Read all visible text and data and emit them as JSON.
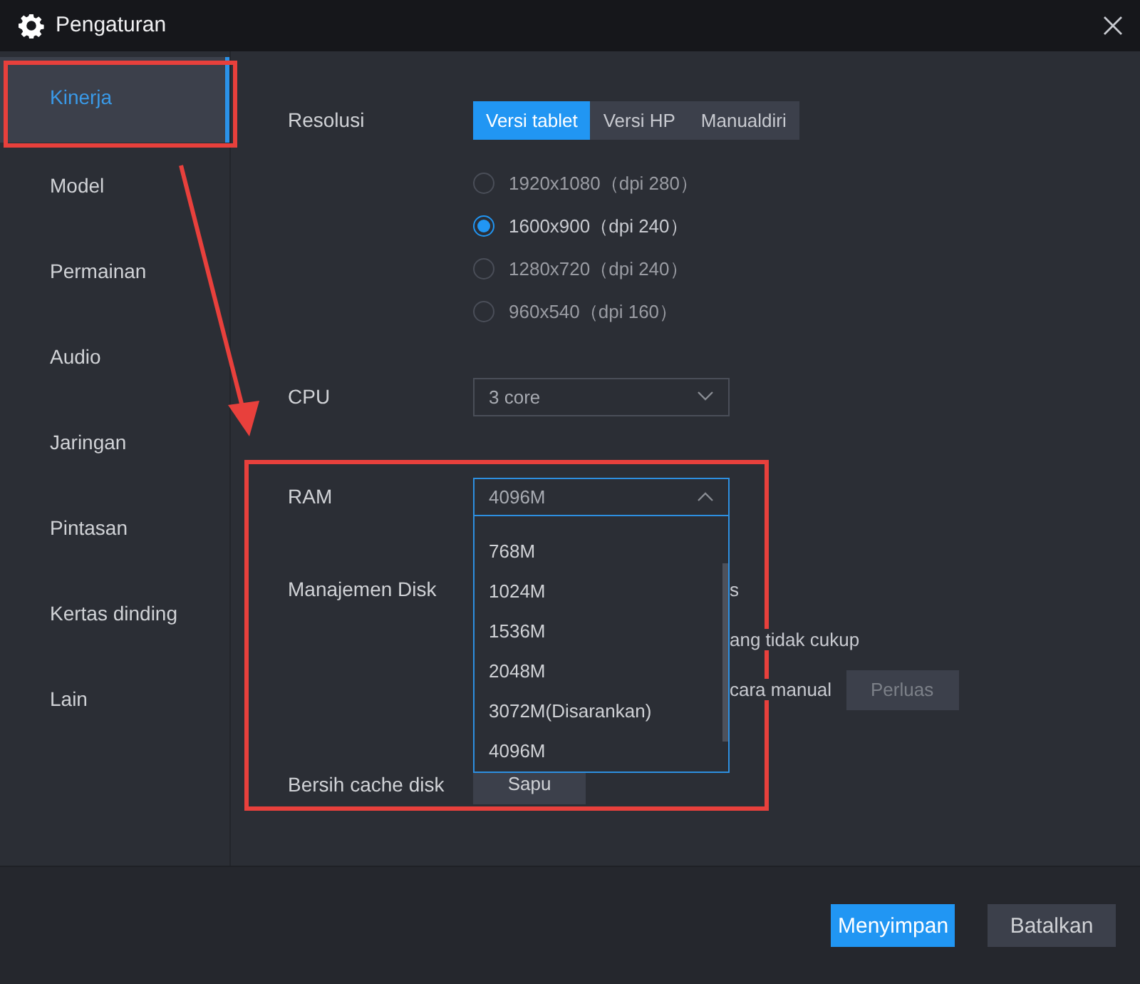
{
  "window": {
    "title": "Pengaturan"
  },
  "sidebar": {
    "items": [
      {
        "label": "Kinerja",
        "selected": true
      },
      {
        "label": "Model",
        "selected": false
      },
      {
        "label": "Permainan",
        "selected": false
      },
      {
        "label": "Audio",
        "selected": false
      },
      {
        "label": "Jaringan",
        "selected": false
      },
      {
        "label": "Pintasan",
        "selected": false
      },
      {
        "label": "Kertas dinding",
        "selected": false
      },
      {
        "label": "Lain",
        "selected": false
      }
    ]
  },
  "resolution": {
    "label": "Resolusi",
    "tabs": [
      {
        "label": "Versi tablet",
        "selected": true
      },
      {
        "label": "Versi HP",
        "selected": false
      },
      {
        "label": "Manualdiri",
        "selected": false
      }
    ],
    "options": [
      {
        "label": "1920x1080（dpi 280）",
        "selected": false
      },
      {
        "label": "1600x900（dpi 240）",
        "selected": true
      },
      {
        "label": "1280x720（dpi 240）",
        "selected": false
      },
      {
        "label": "960x540（dpi 160）",
        "selected": false
      }
    ]
  },
  "cpu": {
    "label": "CPU",
    "value": "3 core",
    "expanded": false
  },
  "ram": {
    "label": "RAM",
    "value": "4096M",
    "expanded": true,
    "options": [
      "768M",
      "1024M",
      "1536M",
      "2048M",
      "3072M(Disarankan)",
      "4096M"
    ]
  },
  "disk": {
    "label": "Manajemen Disk",
    "lines": [
      "s",
      "ang tidak cukup",
      "cara manual"
    ],
    "button": {
      "label": "Perluas",
      "disabled": true
    }
  },
  "cache": {
    "label": "Bersih cache disk",
    "button": "Sapu"
  },
  "footer": {
    "buttons": [
      {
        "label": "Menyimpan",
        "kind": "primary"
      },
      {
        "label": "Batalkan",
        "kind": "secondary"
      }
    ]
  }
}
